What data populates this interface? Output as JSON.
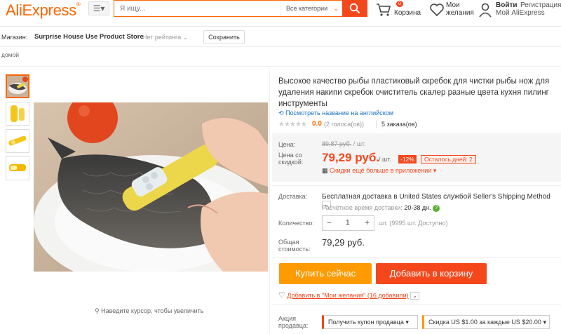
{
  "header": {
    "logo": "AliExpress",
    "logo_mark": "®",
    "search_placeholder": "Я ищу...",
    "category": "Все категории",
    "cart_count": "0",
    "cart_label": "Корзина",
    "wish_line1": "Мои",
    "wish_line2": "желания",
    "login": "Войти",
    "register": "Регистрация",
    "account": "Мой AliExpress",
    "icons": [
      "menu-icon",
      "search-icon",
      "cart-icon",
      "heart-icon",
      "user-icon"
    ]
  },
  "store": {
    "label": "Магазин:",
    "name": "Surprise House Use Product Store",
    "rating": "Нет рейтинга",
    "save": "Сохранить"
  },
  "breadcrumb": "домой",
  "gallery": {
    "hint": "Наведите курсор, чтобы увеличить"
  },
  "product": {
    "title": "Высокое качество рыбы пластиковый скребок для чистки рыбы нож для удаления накипи скребок очиститель скалер разные цвета кухня пилинг инструменты",
    "translate": "Посмотреть название на английском",
    "stars": "★★★★★",
    "score": "0.0",
    "votes": "(2 голоса(ов))",
    "orders": "5 заказа(ов)"
  },
  "price": {
    "label_price": "Цена:",
    "old": "89,87 руб.",
    "old_unit": "/ шт.",
    "label_discount_1": "Цена со",
    "label_discount_2": "скидкой:",
    "current": "79,29 руб.",
    "unit": "/ шт.",
    "discount": "-12%",
    "days_left": "Осталось дней: 2",
    "app_deal": "Скидки ещё больше в приложении"
  },
  "delivery": {
    "label": "Доставка:",
    "text": "Бесплатная доставка в United States службой Seller's Shipping Method",
    "time_label": "Расчётное время доставки:",
    "time": "20-38 дн."
  },
  "quantity": {
    "label": "Количество:",
    "minus": "−",
    "value": "1",
    "plus": "+",
    "available": "шт. (9995 шт. Доступно)"
  },
  "total": {
    "label_1": "Общая",
    "label_2": "стоимость:",
    "value": "79,29 руб."
  },
  "actions": {
    "buy": "Купить сейчас",
    "cart": "Добавить в корзину",
    "wishlist": "Добавить в \"Мои желания\" (16 добавили)"
  },
  "promo": {
    "label_1": "Акция",
    "label_2": "продавца:",
    "coupon": "Получить купон продавца",
    "discount": "Скидка US $1.00 за каждые US $20.00"
  },
  "colors": {
    "accent": "#f5471c",
    "brand": "#ff6a00",
    "buy": "#ff9a00",
    "link": "#1a73c8"
  }
}
